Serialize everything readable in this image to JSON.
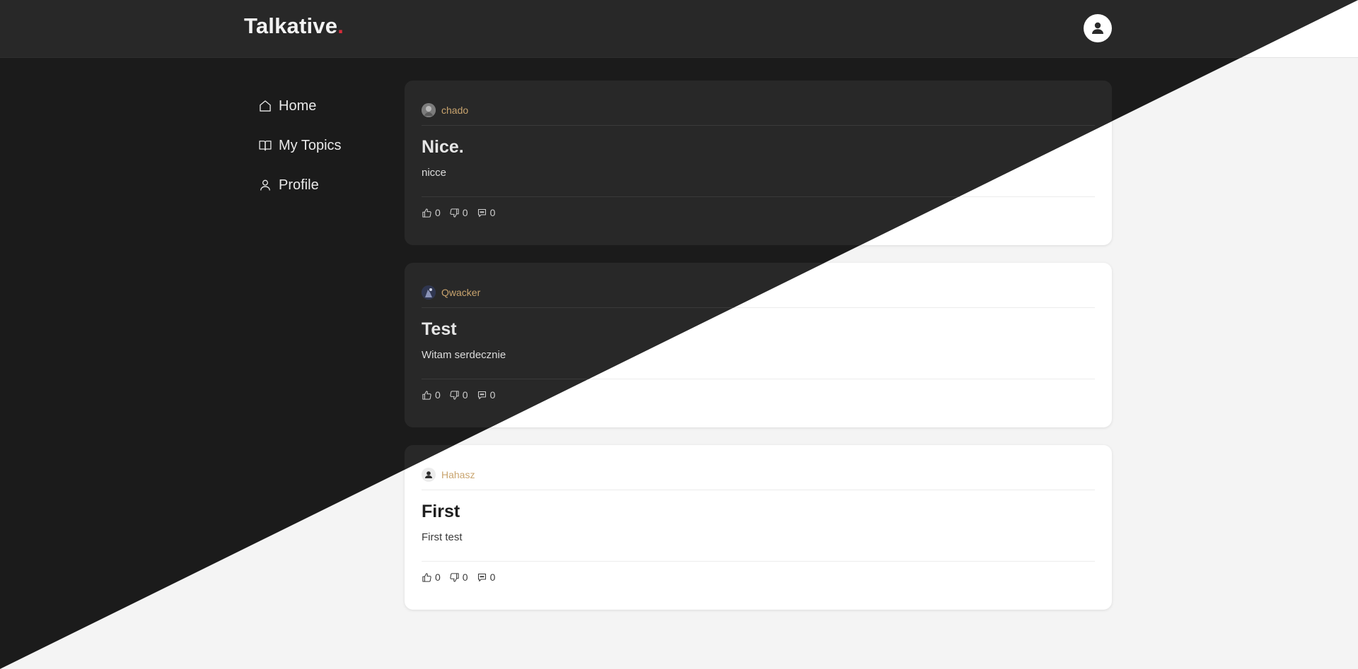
{
  "brand": {
    "name": "Talkative",
    "dot": "."
  },
  "nav": {
    "items": [
      {
        "label": "Home",
        "icon": "home-icon"
      },
      {
        "label": "My Topics",
        "icon": "book-icon"
      },
      {
        "label": "Profile",
        "icon": "user-icon"
      }
    ]
  },
  "posts": [
    {
      "author": "chado",
      "title": "Nice.",
      "body": "nicce",
      "likes": "0",
      "dislikes": "0",
      "comments": "0"
    },
    {
      "author": "Qwacker",
      "title": "Test",
      "body": "Witam serdecznie",
      "likes": "0",
      "dislikes": "0",
      "comments": "0"
    },
    {
      "author": "Hahasz",
      "title": "First",
      "body": "First test",
      "likes": "0",
      "dislikes": "0",
      "comments": "0"
    }
  ],
  "colors": {
    "accent": "#d62d3a",
    "author": "#c9a46e",
    "dark_bg": "#1b1b1b",
    "dark_card": "#282828",
    "light_bg": "#f4f4f4",
    "light_card": "#ffffff"
  }
}
